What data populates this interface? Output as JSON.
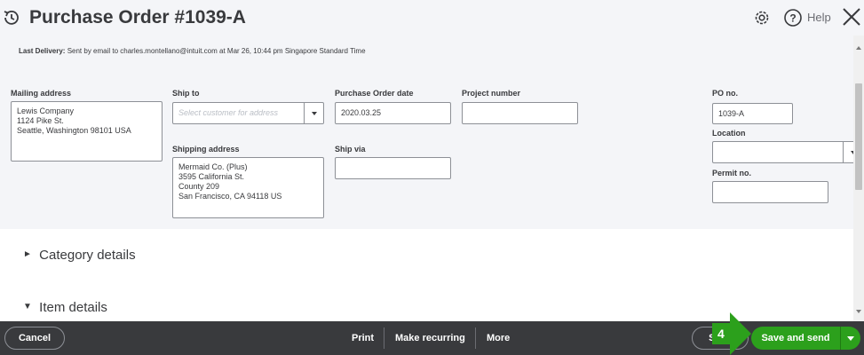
{
  "window": {
    "title": "Purchase Order #1039-A",
    "help_label": "Help"
  },
  "last_delivery": {
    "label": "Last Delivery:",
    "text": " Sent by email to charles.montellano@intuit.com at Mar 26, 10:44 pm Singapore Standard Time"
  },
  "form": {
    "mailing_address": {
      "label": "Mailing address",
      "value": "Lewis Company\n1124 Pike St.\nSeattle, Washington  98101 USA"
    },
    "ship_to": {
      "label": "Ship to",
      "placeholder": "Select customer for address"
    },
    "shipping_address": {
      "label": "Shipping address",
      "value": "Mermaid Co. (Plus)\n3595 California St.\nCounty 209\nSan Francisco, CA  94118 US"
    },
    "po_date": {
      "label": "Purchase Order date",
      "value": "2020.03.25"
    },
    "project_number": {
      "label": "Project number",
      "value": ""
    },
    "ship_via": {
      "label": "Ship via",
      "value": ""
    },
    "po_no": {
      "label": "PO no.",
      "value": "1039-A"
    },
    "location": {
      "label": "Location",
      "value": ""
    },
    "permit_no": {
      "label": "Permit no.",
      "value": ""
    }
  },
  "sections": {
    "category": {
      "label": "Category details",
      "state": "collapsed",
      "arrow": "►"
    },
    "item": {
      "label": "Item details",
      "state": "expanded",
      "arrow": "▼"
    }
  },
  "footer": {
    "cancel": "Cancel",
    "print": "Print",
    "make_recurring": "Make recurring",
    "more": "More",
    "save": "Save",
    "save_and_send": "Save and send"
  },
  "annotation": {
    "step_number": "4"
  },
  "colors": {
    "accent_green": "#2ca01c",
    "footer_bg": "#393a3d",
    "header_bg": "#f4f5f8"
  },
  "icons": [
    "history-icon",
    "gear-icon",
    "help-icon",
    "close-icon",
    "chevron-down-icon"
  ]
}
